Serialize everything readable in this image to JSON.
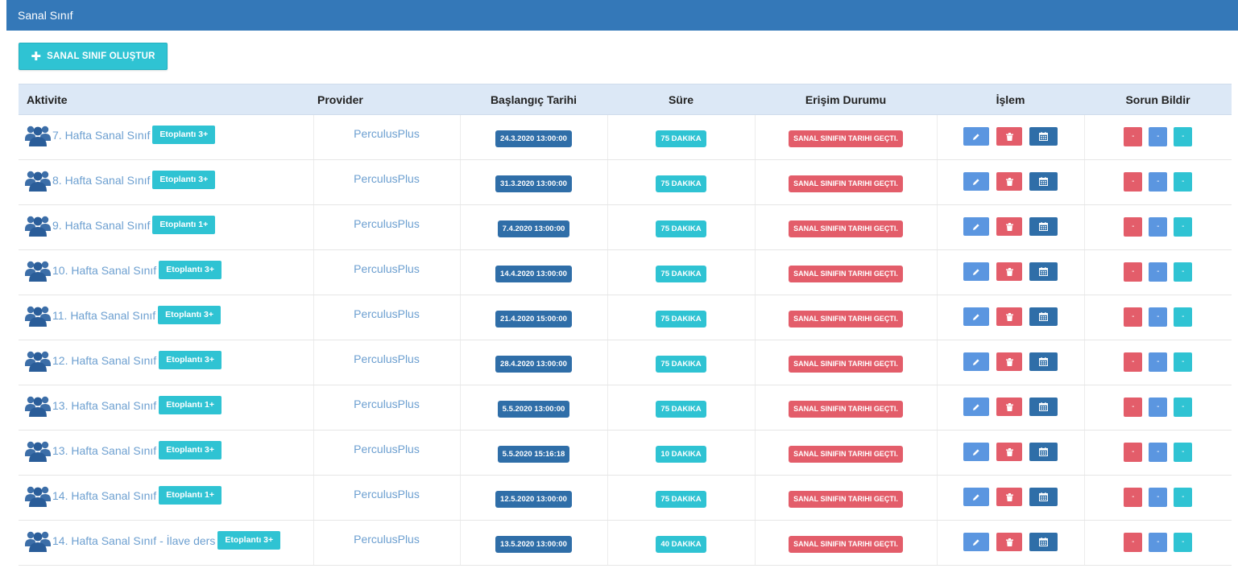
{
  "header": {
    "title": "Sanal Sınıf"
  },
  "toolbar": {
    "create_label": "SANAL SINIF OLUŞTUR",
    "create_icon": "plus-icon"
  },
  "table": {
    "columns": [
      "Aktivite",
      "Provider",
      "Başlangıç Tarihi",
      "Süre",
      "Erişim Durumu",
      "İşlem",
      "Sorun Bildir"
    ],
    "rows": [
      {
        "activity": "7. Hafta Sanal Sınıf",
        "badge": "Etoplantı 3+",
        "provider": "PerculusPlus",
        "start": "24.3.2020 13:00:00",
        "duration": "75 DAKIKA",
        "access": "SANAL SINIFIN TARIHI GEÇTI.",
        "report": [
          "-",
          "-",
          "-"
        ]
      },
      {
        "activity": "8. Hafta Sanal Sınıf",
        "badge": "Etoplantı 3+",
        "provider": "PerculusPlus",
        "start": "31.3.2020 13:00:00",
        "duration": "75 DAKIKA",
        "access": "SANAL SINIFIN TARIHI GEÇTI.",
        "report": [
          "-",
          "-",
          "-"
        ]
      },
      {
        "activity": "9. Hafta Sanal Sınıf",
        "badge": "Etoplantı 1+",
        "provider": "PerculusPlus",
        "start": "7.4.2020 13:00:00",
        "duration": "75 DAKIKA",
        "access": "SANAL SINIFIN TARIHI GEÇTI.",
        "report": [
          "-",
          "-",
          "-"
        ]
      },
      {
        "activity": "10. Hafta Sanal Sınıf",
        "badge": "Etoplantı 3+",
        "provider": "PerculusPlus",
        "start": "14.4.2020 13:00:00",
        "duration": "75 DAKIKA",
        "access": "SANAL SINIFIN TARIHI GEÇTI.",
        "report": [
          "-",
          "-",
          "-"
        ]
      },
      {
        "activity": "11. Hafta Sanal Sınıf",
        "badge": "Etoplantı 3+",
        "provider": "PerculusPlus",
        "start": "21.4.2020 15:00:00",
        "duration": "75 DAKIKA",
        "access": "SANAL SINIFIN TARIHI GEÇTI.",
        "report": [
          "-",
          "-",
          "-"
        ]
      },
      {
        "activity": "12. Hafta Sanal Sınıf",
        "badge": "Etoplantı 3+",
        "provider": "PerculusPlus",
        "start": "28.4.2020 13:00:00",
        "duration": "75 DAKIKA",
        "access": "SANAL SINIFIN TARIHI GEÇTI.",
        "report": [
          "-",
          "-",
          "-"
        ]
      },
      {
        "activity": "13. Hafta Sanal Sınıf",
        "badge": "Etoplantı 1+",
        "provider": "PerculusPlus",
        "start": "5.5.2020 13:00:00",
        "duration": "75 DAKIKA",
        "access": "SANAL SINIFIN TARIHI GEÇTI.",
        "report": [
          "-",
          "-",
          "-"
        ]
      },
      {
        "activity": "13. Hafta Sanal Sınıf",
        "badge": "Etoplantı 3+",
        "provider": "PerculusPlus",
        "start": "5.5.2020 15:16:18",
        "duration": "10 DAKIKA",
        "access": "SANAL SINIFIN TARIHI GEÇTI.",
        "report": [
          "-",
          "-",
          "-"
        ]
      },
      {
        "activity": "14. Hafta Sanal Sınıf",
        "badge": "Etoplantı 1+",
        "provider": "PerculusPlus",
        "start": "12.5.2020 13:00:00",
        "duration": "75 DAKIKA",
        "access": "SANAL SINIFIN TARIHI GEÇTI.",
        "report": [
          "-",
          "-",
          "-"
        ]
      },
      {
        "activity": "14. Hafta Sanal Sınıf - İlave ders",
        "badge": "Etoplantı 3+",
        "provider": "PerculusPlus",
        "start": "13.5.2020 13:00:00",
        "duration": "40 DAKIKA",
        "access": "SANAL SINIFIN TARIHI GEÇTI.",
        "report": [
          "-",
          "-",
          "-"
        ]
      }
    ]
  },
  "icons": {
    "activity": "users-icon",
    "operations": [
      "edit-icon",
      "delete-icon",
      "calendar-icon"
    ]
  },
  "colors": {
    "header": "#3478b8",
    "accent_cyan": "#2fc3d3",
    "date_label": "#2f6ea8",
    "danger": "#e35d6a",
    "primary_blue": "#5b96e0",
    "link": "#6c9fd0",
    "table_header": "#dce8f6"
  }
}
